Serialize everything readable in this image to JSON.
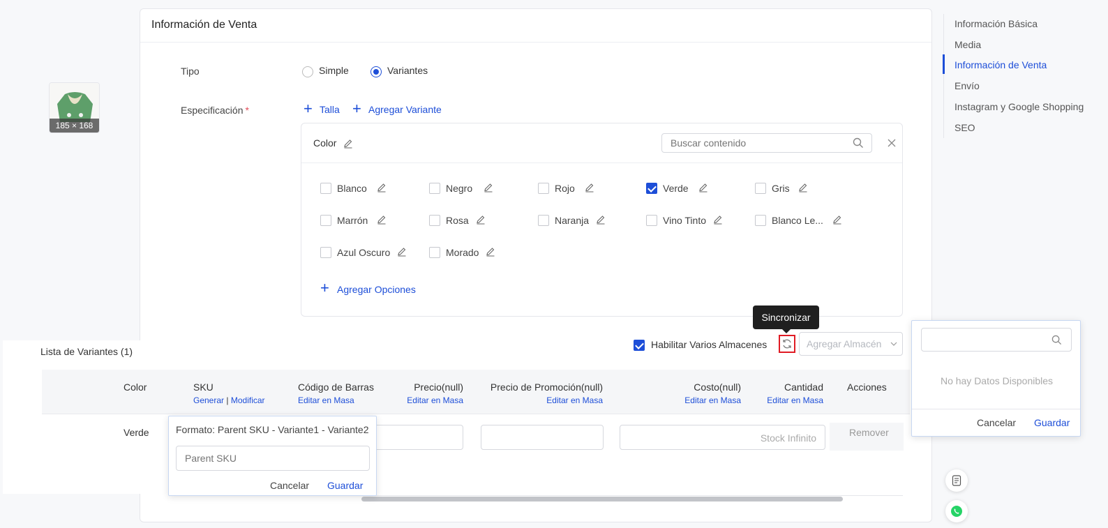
{
  "sales_card": {
    "title": "Información de Venta",
    "tipo_label": "Tipo",
    "tipo_options": [
      {
        "label": "Simple",
        "selected": false
      },
      {
        "label": "Variantes",
        "selected": true
      }
    ],
    "spec_label": "Especificación",
    "required_mark": "*",
    "add_size": "Talla",
    "add_variant": "Agregar Variante"
  },
  "spec_box": {
    "title": "Color",
    "search_placeholder": "Buscar contenido",
    "options": [
      {
        "label": "Blanco",
        "checked": false
      },
      {
        "label": "Negro",
        "checked": false
      },
      {
        "label": "Rojo",
        "checked": false
      },
      {
        "label": "Verde",
        "checked": true
      },
      {
        "label": "Gris",
        "checked": false
      },
      {
        "label": "Marrón",
        "checked": false
      },
      {
        "label": "Rosa",
        "checked": false
      },
      {
        "label": "Naranja",
        "checked": false
      },
      {
        "label": "Vino Tinto",
        "checked": false
      },
      {
        "label": "Blanco Le...",
        "checked": false
      },
      {
        "label": "Azul Oscuro",
        "checked": false
      },
      {
        "label": "Morado",
        "checked": false
      }
    ],
    "add_options": "Agregar Opciones"
  },
  "warehouse": {
    "tooltip": "Sincronizar",
    "enable_label": "Habilitar Varios Almacenes",
    "enable_checked": true,
    "select_placeholder": "Agregar Almacén"
  },
  "right_nav": {
    "items": [
      {
        "label": "Información Básica",
        "active": false
      },
      {
        "label": "Media",
        "active": false
      },
      {
        "label": "Información de Venta",
        "active": true
      },
      {
        "label": "Envío",
        "active": false
      },
      {
        "label": "Instagram y Google Shopping",
        "active": false
      },
      {
        "label": "SEO",
        "active": false
      }
    ]
  },
  "variant_list": {
    "title": "Lista de Variantes (1)",
    "columns": {
      "color": "Color",
      "sku": "SKU",
      "sku_generate": "Generar",
      "sku_sep": "|",
      "sku_modify": "Modificar",
      "barcode": "Código de Barras",
      "barcode_sub": "Editar en Masa",
      "price": "Precio(null)",
      "price_sub": "Editar en Masa",
      "promo": "Precio de Promoción(null)",
      "promo_sub": "Editar en Masa",
      "cost": "Costo(null)",
      "cost_sub": "Editar en Masa",
      "qty": "Cantidad",
      "qty_sub": "Editar en Masa",
      "actions": "Acciones"
    },
    "row": {
      "image_caption": "185 × 168",
      "color": "Verde",
      "qty_placeholder": "Stock Infinito",
      "remove": "Remover"
    }
  },
  "sku_popover": {
    "format_text": "Formato: Parent SKU - Variante1 - Variante2",
    "input_placeholder": "Parent SKU",
    "cancel": "Cancelar",
    "save": "Guardar"
  },
  "warehouse_dropdown": {
    "empty_text": "No hay Datos Disponibles",
    "cancel": "Cancelar",
    "save": "Guardar"
  },
  "colors": {
    "accent": "#1d4ed8",
    "danger": "#e01b24",
    "whatsapp": "#25d366"
  }
}
